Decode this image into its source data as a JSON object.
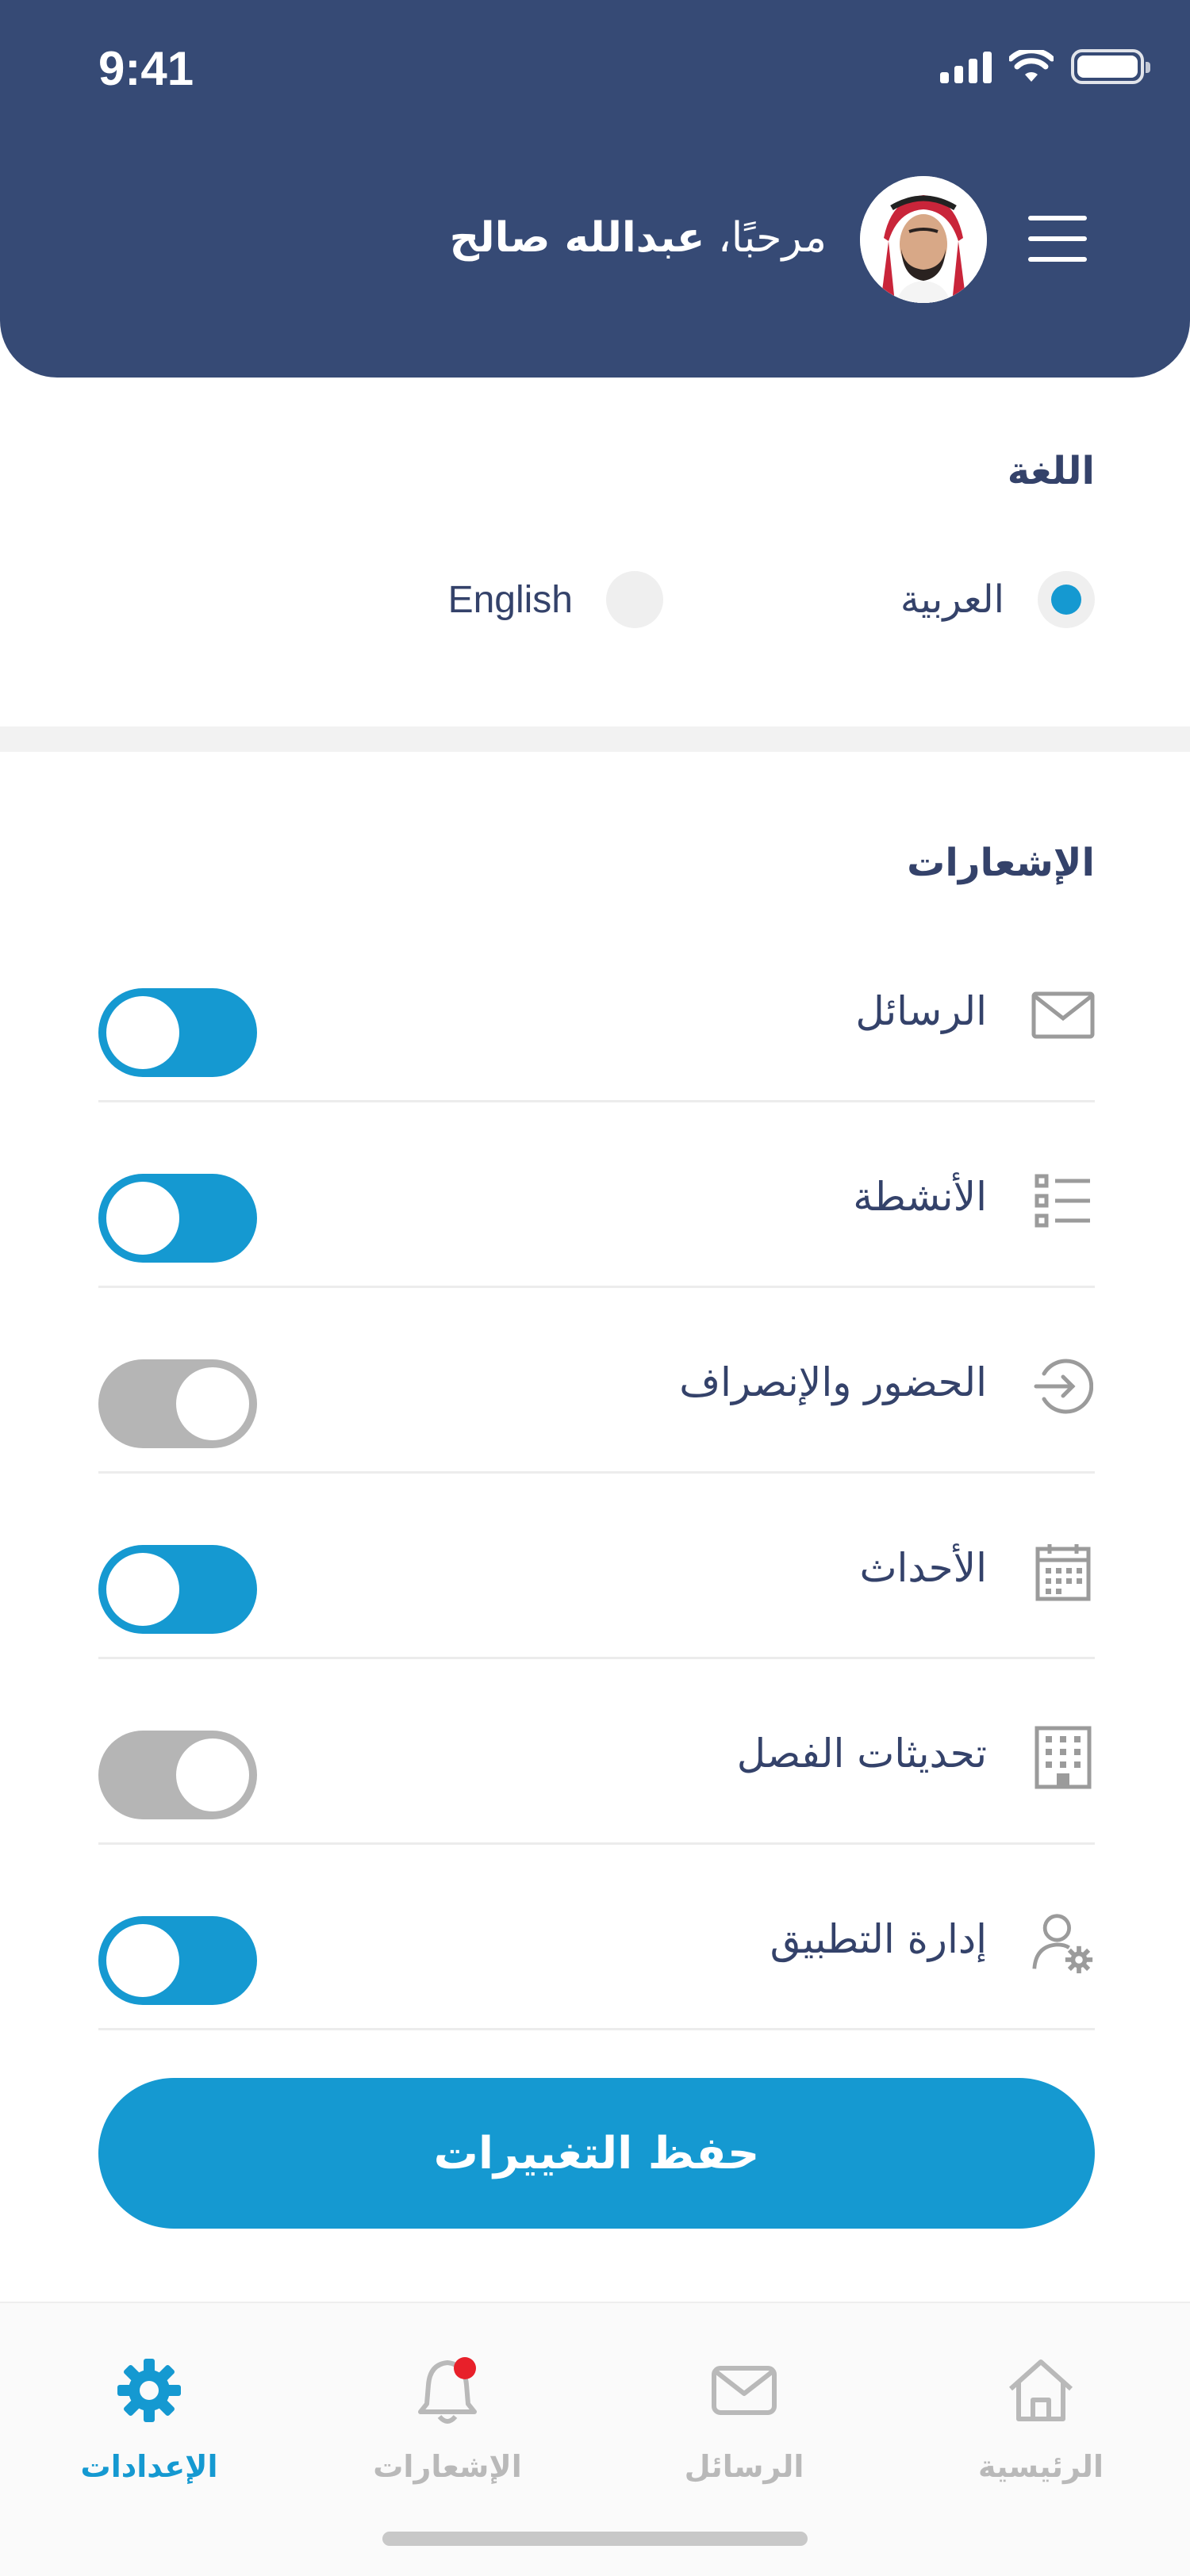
{
  "status_bar": {
    "time": "9:41"
  },
  "header": {
    "greeting_prefix": "مرحبًا، ",
    "user_name": "عبدالله صالح"
  },
  "language": {
    "title": "اللغة",
    "options": [
      {
        "label": "العربية",
        "selected": true
      },
      {
        "label": "English",
        "selected": false
      }
    ]
  },
  "notifications": {
    "title": "الإشعارات",
    "items": [
      {
        "label": "الرسائل",
        "icon": "mail-icon",
        "enabled": true
      },
      {
        "label": "الأنشطة",
        "icon": "list-icon",
        "enabled": true
      },
      {
        "label": "الحضور والإنصراف",
        "icon": "sign-in-icon",
        "enabled": false
      },
      {
        "label": "الأحداث",
        "icon": "calendar-icon",
        "enabled": true
      },
      {
        "label": "تحديثات الفصل",
        "icon": "building-icon",
        "enabled": false
      },
      {
        "label": "إدارة التطبيق",
        "icon": "user-settings-icon",
        "enabled": true
      }
    ]
  },
  "save_button": {
    "label": "حفظ التغييرات"
  },
  "bottom_nav": {
    "items": [
      {
        "label": "الإعدادات",
        "icon": "gear-icon",
        "active": true
      },
      {
        "label": "الإشعارات",
        "icon": "bell-icon",
        "active": false,
        "badge": true
      },
      {
        "label": "الرسائل",
        "icon": "mail-icon",
        "active": false
      },
      {
        "label": "الرئيسية",
        "icon": "home-icon",
        "active": false
      }
    ]
  },
  "colors": {
    "header_bg": "#364a75",
    "accent": "#1599d1",
    "toggle_off": "#b5b5b5",
    "text": "#34426a",
    "badge": "#e8202a"
  }
}
